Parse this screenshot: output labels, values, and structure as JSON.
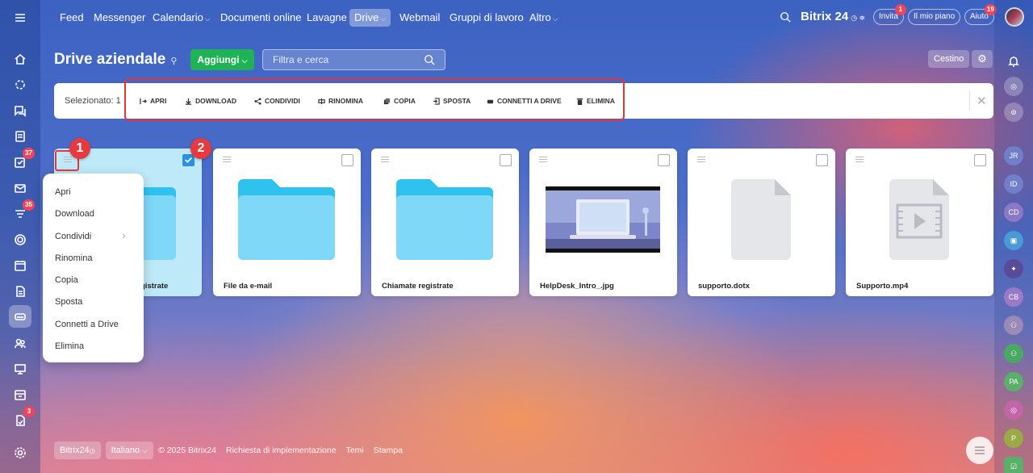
{
  "topnav": {
    "items": [
      "Feed",
      "Messenger",
      "Calendario",
      "Documenti online",
      "Lavagne",
      "Drive",
      "Webmail",
      "Gruppi di lavoro",
      "Altro"
    ],
    "brand": "Bitrix 24",
    "invite": "Invita",
    "invite_badge": "1",
    "plan": "Il mio piano",
    "help": "Aiuto",
    "help_badge": "19"
  },
  "sidebar": {
    "badges": {
      "tasks": "37",
      "feed": "35",
      "automation": "3"
    }
  },
  "rightbar": {
    "avatars": [
      "JR",
      "ID",
      "CD",
      "CB",
      "PA",
      "P"
    ]
  },
  "header": {
    "title": "Drive aziendale",
    "add_button": "Aggiungi",
    "search_placeholder": "Filtra e cerca",
    "trash_button": "Cestino"
  },
  "toolbar": {
    "selected_label": "Selezionato: 1",
    "actions": [
      "APRI",
      "DOWNLOAD",
      "CONDIVIDI",
      "RINOMINA",
      "COPIA",
      "SPOSTA",
      "CONNETTI A DRIVE",
      "ELIMINA"
    ]
  },
  "files": [
    {
      "name": "Chiamate registrate",
      "visible_name": "gistrate",
      "type": "folder",
      "selected": true
    },
    {
      "name": "File da e-mail",
      "type": "folder",
      "selected": false
    },
    {
      "name": "Chiamate registrate",
      "type": "folder",
      "selected": false
    },
    {
      "name": "HelpDesk_Intro_.jpg",
      "type": "image",
      "selected": false
    },
    {
      "name": "supporto.dotx",
      "type": "document",
      "selected": false
    },
    {
      "name": "Supporto.mp4",
      "type": "video",
      "selected": false
    }
  ],
  "context_menu": {
    "items": [
      "Apri",
      "Download",
      "Condividi",
      "Rinomina",
      "Copia",
      "Sposta",
      "Connetti a Drive",
      "Elimina"
    ]
  },
  "callouts": [
    "1",
    "2"
  ],
  "footer": {
    "brand": "Bitrix24",
    "language": "Italiano",
    "copyright": "© 2025 Bitrix24",
    "links": [
      "Richiesta di implementazione",
      "Temi",
      "Stampa"
    ]
  },
  "colors": {
    "accent_green": "#20b356",
    "callout_red": "#e63a3f",
    "folder_blue": "#7fd8f8",
    "checkbox_blue": "#2b8fe3"
  }
}
